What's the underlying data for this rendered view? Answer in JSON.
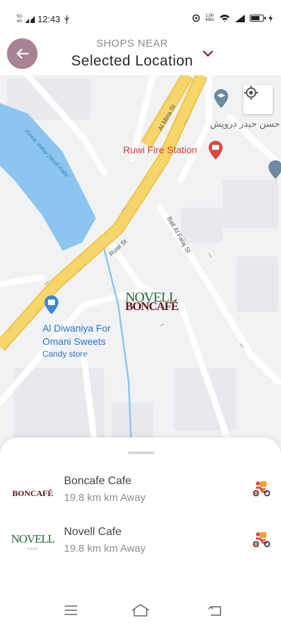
{
  "status_bar": {
    "network_top": "5G",
    "network_bottom": "4G",
    "time": "12:43",
    "speed_value": "1.00",
    "speed_unit": "KB/s"
  },
  "header": {
    "subtitle": "SHOPS NEAR",
    "title": "Selected Location",
    "back_icon": "arrow-left-icon",
    "dropdown_icon": "chevron-down-icon",
    "back_bg_color": "#a98293",
    "dropdown_color": "#7a1c2c"
  },
  "map": {
    "streets": [
      "Al Mina St",
      "Ruwi St",
      "Bait Al Falaj St",
      "(Great Valley (Wadi Kabir"
    ],
    "place_fire_station": "Ruwi Fire Station",
    "place_arabic": "حسن حيدر درويش",
    "place_sweets_line1": "Al Diwaniya For",
    "place_sweets_line2": "Omani Sweets",
    "place_sweets_category": "Candy store",
    "marker_logo_top": "NOVELL",
    "marker_logo_bottom": "BONCAFÉ",
    "locate_icon": "crosshair-icon",
    "road_color": "#f6d56a",
    "water_color": "#8cc6f0"
  },
  "shops": [
    {
      "name": "Boncafe Cafe",
      "distance": "19.8 km km Away",
      "logo_text": "BONCAFÉ",
      "icon": "delivery-scooter-icon"
    },
    {
      "name": "Novell Cafe",
      "distance": "19.8 km km Away",
      "logo_text": "NOVELL",
      "logo_subtext": "CAFE",
      "icon": "delivery-scooter-icon"
    }
  ],
  "navbar": {
    "menu_icon": "menu-icon",
    "home_icon": "home-icon",
    "back_icon": "back-nav-icon"
  }
}
